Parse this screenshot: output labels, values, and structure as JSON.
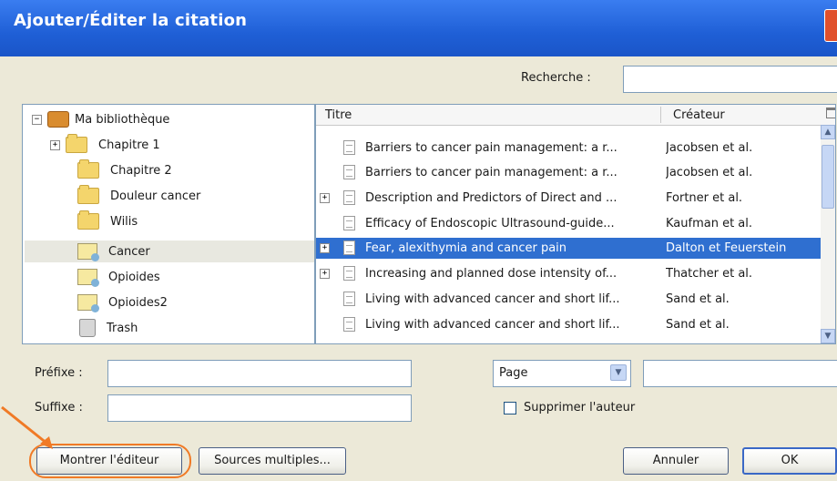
{
  "window": {
    "title": "Ajouter/Éditer la citation"
  },
  "search": {
    "label": "Recherche :",
    "value": ""
  },
  "library": {
    "items": [
      {
        "label": "Ma bibliothèque",
        "icon": "library-icon",
        "expander": "−"
      },
      {
        "label": "Chapitre 1",
        "icon": "folder-icon",
        "expander": "+"
      },
      {
        "label": "Chapitre 2",
        "icon": "folder-icon"
      },
      {
        "label": "Douleur cancer",
        "icon": "folder-icon"
      },
      {
        "label": "Wilis",
        "icon": "folder-icon"
      },
      {
        "label": "Cancer",
        "icon": "saved-search-icon",
        "selected": true
      },
      {
        "label": "Opioides",
        "icon": "saved-search-icon"
      },
      {
        "label": "Opioides2",
        "icon": "saved-search-icon"
      },
      {
        "label": "Trash",
        "icon": "trash-icon"
      }
    ]
  },
  "items_table": {
    "headers": {
      "title": "Titre",
      "creator": "Créateur"
    },
    "rows": [
      {
        "title": "Barriers to cancer pain management: a r...",
        "creator": "Jacobsen et al.",
        "expandable": false
      },
      {
        "title": "Barriers to cancer pain management: a r...",
        "creator": "Jacobsen et al.",
        "expandable": false
      },
      {
        "title": "Description and Predictors of Direct and ...",
        "creator": "Fortner et al.",
        "expandable": true
      },
      {
        "title": "Efficacy of Endoscopic Ultrasound-guide...",
        "creator": "Kaufman et al.",
        "expandable": false
      },
      {
        "title": "Fear, alexithymia and cancer pain",
        "creator": "Dalton et Feuerstein",
        "expandable": true,
        "selected": true
      },
      {
        "title": "Increasing and planned dose intensity of...",
        "creator": "Thatcher et al.",
        "expandable": true
      },
      {
        "title": "Living with advanced cancer and short lif...",
        "creator": "Sand et al.",
        "expandable": false
      },
      {
        "title": "Living with advanced cancer and short lif...",
        "creator": "Sand et al.",
        "expandable": false
      }
    ]
  },
  "form": {
    "prefix_label": "Préfixe :",
    "suffix_label": "Suffixe :",
    "prefix_value": "",
    "suffix_value": "",
    "locator_select": "Page",
    "locator_value": "",
    "suppress_author_label": "Supprimer l'auteur",
    "suppress_author_checked": false
  },
  "buttons": {
    "show_editor": "Montrer l'éditeur",
    "multiple_sources": "Sources multiples...",
    "cancel": "Annuler",
    "ok": "OK"
  },
  "colors": {
    "accent": "#2f6fd0",
    "title_bar": "#1f5fd6",
    "annotation": "#f07a26"
  }
}
